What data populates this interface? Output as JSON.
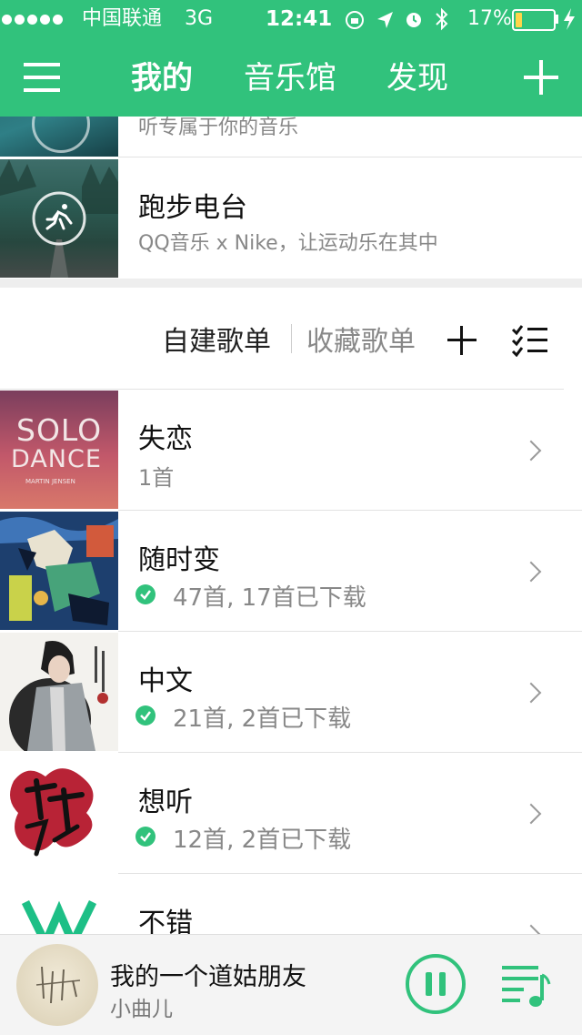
{
  "status_bar": {
    "carrier": "中国联通",
    "network": "3G",
    "time": "12:41",
    "battery": "17%",
    "battery_level": 0.17
  },
  "nav": {
    "tabs": [
      {
        "label": "我的",
        "active": true
      },
      {
        "label": "音乐馆",
        "active": false
      },
      {
        "label": "发现",
        "active": false
      }
    ],
    "menu_icon": "menu-icon",
    "add_icon": "plus-icon"
  },
  "radio": {
    "partial_subtitle": "听专属于你的音乐",
    "running": {
      "title": "跑步电台",
      "subtitle": "QQ音乐 x Nike，让运动乐在其中"
    }
  },
  "playlist_section": {
    "tab_created": "自建歌单",
    "tab_collected": "收藏歌单"
  },
  "playlists": [
    {
      "title": "失恋",
      "count": "1首",
      "downloaded": false,
      "cover_text": [
        "SOLO",
        "DANCE",
        "MARTIN JENSEN"
      ]
    },
    {
      "title": "随时变",
      "count": "47首, 17首已下载",
      "downloaded": true
    },
    {
      "title": "中文",
      "count": "21首, 2首已下载",
      "downloaded": true
    },
    {
      "title": "想听",
      "count": "12首, 2首已下载",
      "downloaded": true
    },
    {
      "title": "不错",
      "count": "",
      "downloaded": false
    }
  ],
  "player": {
    "song": "我的一个道姑朋友",
    "artist": "小曲儿"
  },
  "colors": {
    "brand": "#31c27c",
    "divider": "#e2e2e2",
    "sub_text": "#888888"
  }
}
